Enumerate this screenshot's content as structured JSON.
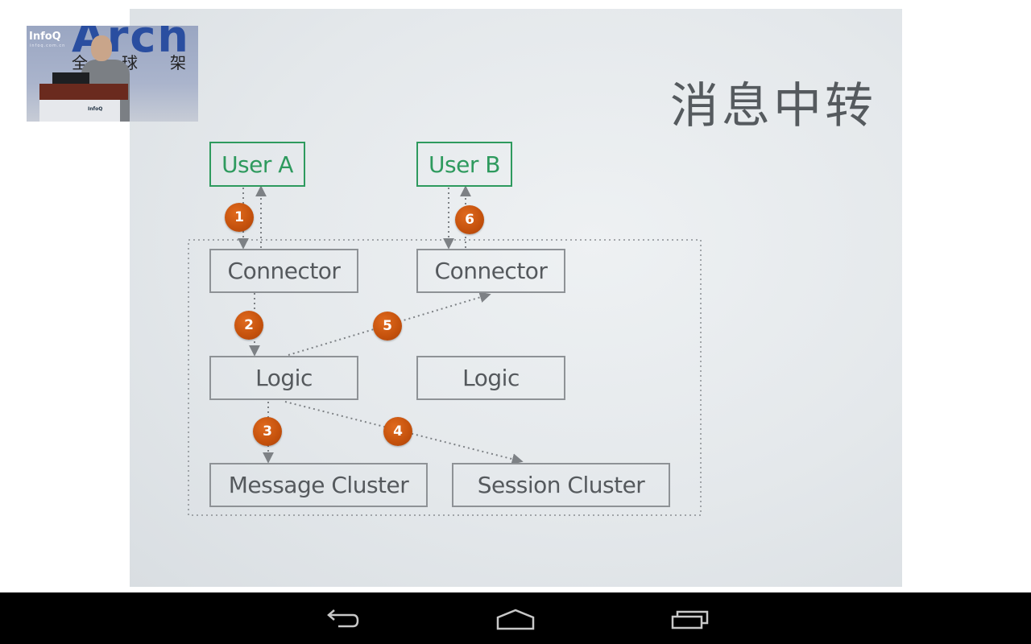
{
  "slide": {
    "title": "消息中转",
    "nodes": {
      "user_a": "User A",
      "user_b": "User B",
      "connector_a": "Connector",
      "connector_b": "Connector",
      "logic_a": "Logic",
      "logic_b": "Logic",
      "message_cluster": "Message Cluster",
      "session_cluster": "Session Cluster"
    },
    "steps": [
      "1",
      "2",
      "3",
      "4",
      "5",
      "6"
    ],
    "colors": {
      "user_border": "#2e9a5e",
      "node_border": "#8e9296",
      "badge": "#c4510c",
      "arrow": "#7d8185"
    }
  },
  "video_overlay": {
    "logo": "InfoQ",
    "logo_sub": "infoq.com.cn",
    "banner": "Arch",
    "banner_cjk": [
      "全",
      "球",
      "架"
    ],
    "podium_label": "InfoQ"
  },
  "navbar": {
    "back": "back-icon",
    "home": "home-icon",
    "recents": "recents-icon"
  }
}
